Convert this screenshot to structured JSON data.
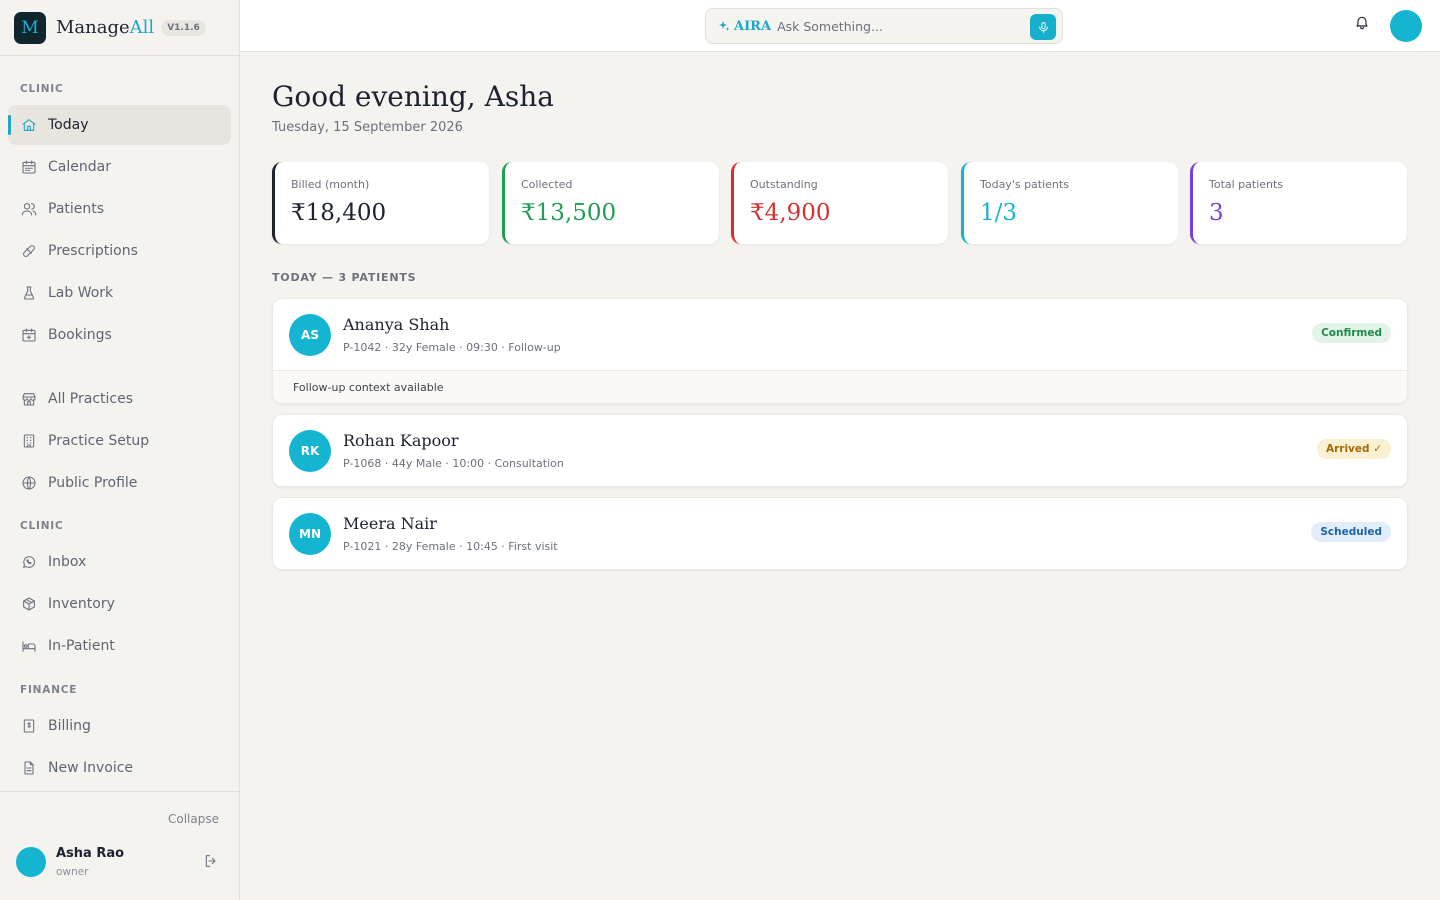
{
  "brand": {
    "logo_letter": "M",
    "name_main": "Manage",
    "name_accent": "All",
    "version": "V1.1.6"
  },
  "sidebar": {
    "sections": [
      "CLINIC",
      "CLINIC",
      "FINANCE"
    ],
    "items": [
      {
        "label": "Today",
        "icon": "home-icon"
      },
      {
        "label": "Calendar",
        "icon": "calendar-icon"
      },
      {
        "label": "Patients",
        "icon": "users-icon"
      },
      {
        "label": "Prescriptions",
        "icon": "pill-icon"
      },
      {
        "label": "Lab Work",
        "icon": "flask-icon"
      },
      {
        "label": "Bookings",
        "icon": "calendar-plus-icon"
      },
      {
        "label": "All Practices",
        "icon": "store-icon"
      },
      {
        "label": "Practice Setup",
        "icon": "building-icon"
      },
      {
        "label": "Public Profile",
        "icon": "globe-icon"
      },
      {
        "label": "Inbox",
        "icon": "whatsapp-icon"
      },
      {
        "label": "Inventory",
        "icon": "box-icon"
      },
      {
        "label": "In-Patient",
        "icon": "bed-icon"
      },
      {
        "label": "Billing",
        "icon": "receipt-icon"
      },
      {
        "label": "New Invoice",
        "icon": "file-text-icon"
      }
    ],
    "collapse_label": "Collapse",
    "user": {
      "name": "Asha Rao",
      "role": "owner"
    }
  },
  "topbar": {
    "aira_label": "AIRA",
    "search_placeholder": "Ask Something..."
  },
  "main": {
    "greeting": "Good evening, Asha",
    "date": "Tuesday, 15 September 2026",
    "stats": [
      {
        "label": "Billed (month)",
        "value": "₹18,400",
        "color": "#1c2230"
      },
      {
        "label": "Collected",
        "value": "₹13,500",
        "color": "#1f9d55"
      },
      {
        "label": "Outstanding",
        "value": "₹4,900",
        "color": "#d62f2f"
      },
      {
        "label": "Today's patients",
        "value": "1/3",
        "color": "#17b3cf"
      },
      {
        "label": "Total patients",
        "value": "3",
        "color": "#7b3fd9"
      }
    ],
    "section_title": "TODAY — 3 PATIENTS",
    "appointments": [
      {
        "initials": "AS",
        "name": "Ananya Shah",
        "meta": "P-1042 · 32y Female · 09:30 · Follow-up",
        "status": "Confirmed",
        "status_color": "#1f8a4a",
        "status_bg": "#e2f4e8",
        "context": "Follow-up context available"
      },
      {
        "initials": "RK",
        "name": "Rohan Kapoor",
        "meta": "P-1068 · 44y Male · 10:00 · Consultation",
        "status": "Arrived ✓",
        "status_color": "#a46a07",
        "status_bg": "#fbf0d2"
      },
      {
        "initials": "MN",
        "name": "Meera Nair",
        "meta": "P-1021 · 28y Female · 10:45 · First visit",
        "status": "Scheduled",
        "status_color": "#1e63a8",
        "status_bg": "#e1edf8"
      }
    ]
  }
}
